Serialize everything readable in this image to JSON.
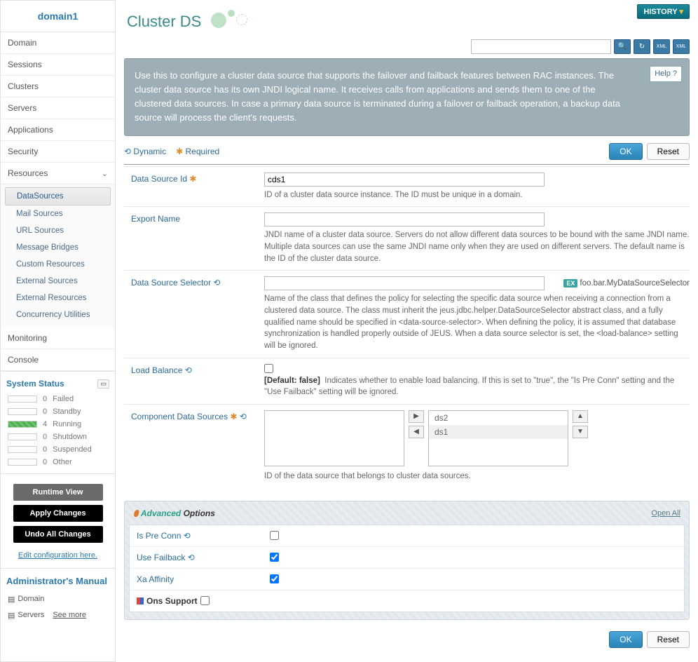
{
  "domain_title": "domain1",
  "nav": {
    "domain": "Domain",
    "sessions": "Sessions",
    "clusters": "Clusters",
    "servers": "Servers",
    "applications": "Applications",
    "security": "Security",
    "resources": "Resources",
    "monitoring": "Monitoring",
    "console": "Console"
  },
  "resources_sub": {
    "data_sources": "DataSources",
    "mail_sources": "Mail Sources",
    "url_sources": "URL Sources",
    "message_bridges": "Message Bridges",
    "custom_resources": "Custom Resources",
    "external_sources": "External Sources",
    "external_resources": "External Resources",
    "concurrency_utilities": "Concurrency Utilities"
  },
  "system_status": {
    "title": "System Status",
    "items": [
      {
        "count": "0",
        "label": "Failed"
      },
      {
        "count": "0",
        "label": "Standby"
      },
      {
        "count": "4",
        "label": "Running"
      },
      {
        "count": "0",
        "label": "Shutdown"
      },
      {
        "count": "0",
        "label": "Suspended"
      },
      {
        "count": "0",
        "label": "Other"
      }
    ]
  },
  "actions": {
    "runtime_view": "Runtime View",
    "apply_changes": "Apply Changes",
    "undo_all": "Undo All Changes",
    "edit_link": "Edit configuration here."
  },
  "manual": {
    "title": "Administrator's Manual",
    "domain": "Domain",
    "servers": "Servers",
    "see_more": "See more"
  },
  "history_btn": "HISTORY",
  "page_title": "Cluster DS",
  "info_text": "Use this to configure a cluster data source that supports the failover and failback features between RAC instances. The cluster data source has its own JNDI logical name. It receives calls from applications and sends them to one of the clustered data sources. In case a primary data source is terminated during a failover or failback operation, a backup data source will process the client's requests.",
  "help": "Help",
  "legend": {
    "dynamic": "Dynamic",
    "required": "Required"
  },
  "buttons": {
    "ok": "OK",
    "reset": "Reset",
    "open_all": "Open All"
  },
  "form": {
    "data_source_id": {
      "label": "Data Source Id",
      "value": "cds1",
      "help": "ID of a cluster data source instance. The ID must be unique in a domain."
    },
    "export_name": {
      "label": "Export Name",
      "value": "",
      "help": "JNDI name of a cluster data source. Servers do not allow different data sources to be bound with the same JNDI name. Multiple data sources can use the same JNDI name only when they are used on different servers. The default name is the ID of the cluster data source."
    },
    "selector": {
      "label": "Data Source Selector",
      "value": "",
      "example": "foo.bar.MyDataSourceSelector",
      "help": "Name of the class that defines the policy for selecting the specific data source when receiving a connection from a clustered data source. The class must inherit the jeus.jdbc.helper.DataSourceSelector abstract class, and a fully qualified name should be specified in <data-source-selector>. When defining the policy, it is assumed that database synchronization is handled properly outside of JEUS. When a data source selector is set, the <load-balance> setting will be ignored."
    },
    "load_balance": {
      "label": "Load Balance",
      "default": "[Default: false]",
      "help": "Indicates whether to enable load balancing. If this is set to \"true\", the \"Is Pre Conn\" setting and the \"Use Failback\" setting will be ignored."
    },
    "component": {
      "label": "Component Data Sources",
      "right_items": [
        "ds2",
        "ds1"
      ],
      "help": "ID of the data source that belongs to cluster data sources."
    }
  },
  "advanced": {
    "title_a": "Advanced",
    "title_b": "Options",
    "is_pre_conn": "Is Pre Conn",
    "use_failback": "Use Failback",
    "xa_affinity": "Xa Affinity",
    "ons_support": "Ons Support"
  }
}
